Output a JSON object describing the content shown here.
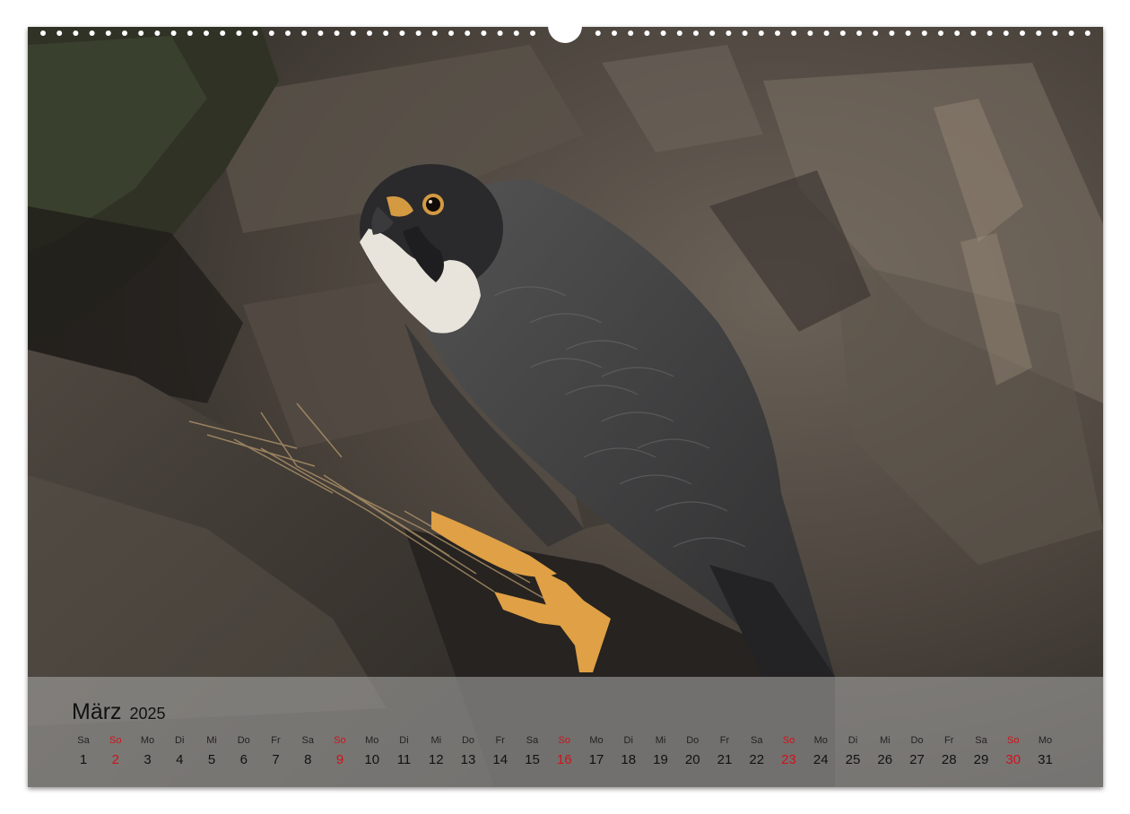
{
  "calendar": {
    "month": "März",
    "year": "2025",
    "days": [
      {
        "wd": "Sa",
        "d": "1"
      },
      {
        "wd": "So",
        "d": "2"
      },
      {
        "wd": "Mo",
        "d": "3"
      },
      {
        "wd": "Di",
        "d": "4"
      },
      {
        "wd": "Mi",
        "d": "5"
      },
      {
        "wd": "Do",
        "d": "6"
      },
      {
        "wd": "Fr",
        "d": "7"
      },
      {
        "wd": "Sa",
        "d": "8"
      },
      {
        "wd": "So",
        "d": "9"
      },
      {
        "wd": "Mo",
        "d": "10"
      },
      {
        "wd": "Di",
        "d": "11"
      },
      {
        "wd": "Mi",
        "d": "12"
      },
      {
        "wd": "Do",
        "d": "13"
      },
      {
        "wd": "Fr",
        "d": "14"
      },
      {
        "wd": "Sa",
        "d": "15"
      },
      {
        "wd": "So",
        "d": "16"
      },
      {
        "wd": "Mo",
        "d": "17"
      },
      {
        "wd": "Di",
        "d": "18"
      },
      {
        "wd": "Mi",
        "d": "19"
      },
      {
        "wd": "Do",
        "d": "20"
      },
      {
        "wd": "Fr",
        "d": "21"
      },
      {
        "wd": "Sa",
        "d": "22"
      },
      {
        "wd": "So",
        "d": "23"
      },
      {
        "wd": "Mo",
        "d": "24"
      },
      {
        "wd": "Di",
        "d": "25"
      },
      {
        "wd": "Mi",
        "d": "26"
      },
      {
        "wd": "Do",
        "d": "27"
      },
      {
        "wd": "Fr",
        "d": "28"
      },
      {
        "wd": "Sa",
        "d": "29"
      },
      {
        "wd": "So",
        "d": "30"
      },
      {
        "wd": "Mo",
        "d": "31"
      }
    ]
  },
  "colors": {
    "sunday": "#d0121b",
    "footer_band": "#a0a09e",
    "text": "#111111"
  },
  "photo": {
    "subject": "peregrine-falcon-on-rock"
  }
}
